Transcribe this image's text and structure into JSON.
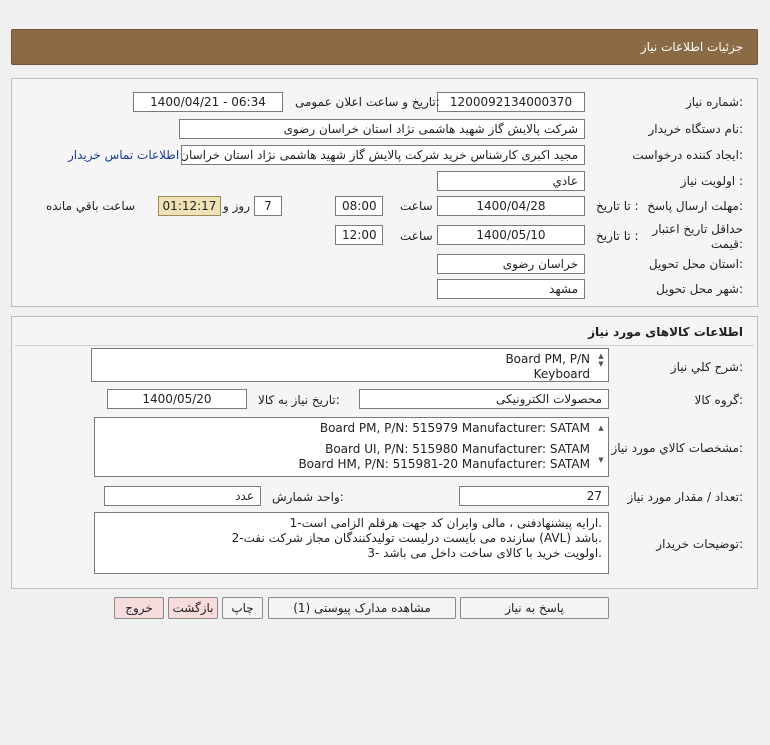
{
  "page_title": "جزئیات اطلاعات نیاز",
  "fields": {
    "need_number_label": "شماره نیاز:",
    "need_number": "1200092134000370",
    "announce_label": "تاریخ و ساعت اعلان عمومی:",
    "announce_value": "1400/04/21 - 06:34",
    "buyer_label": "نام دستگاه خریدار:",
    "buyer_value": "شرکت پالایش گاز شهید هاشمی نژاد   استان خراسان رضوی",
    "creator_label": "ایجاد کننده درخواست:",
    "creator_value": "مجید اکبری کارشناس خرید شرکت پالایش گاز شهید هاشمی نژاد   استان خراسان رضوی",
    "contact_link": "اطلاعات تماس خریدار",
    "priority_label": "اولویت نیاز :",
    "priority_value": "عادي",
    "deadline_label": "مهلت ارسال پاسخ:",
    "to_date_label": "تا تاریخ :",
    "deadline_date": "1400/04/28",
    "time_label": "ساعت",
    "deadline_time": "08:00",
    "days_value": "7",
    "days_label": "روز و",
    "remaining_time": "01:12:17",
    "remaining_label": "ساعت باقي مانده",
    "validity_label_1": "حداقل تاریخ اعتبار",
    "validity_label_2": "قیمت:",
    "validity_date": "1400/05/10",
    "validity_time": "12:00",
    "province_label": "استان محل تحویل:",
    "province_value": "خراسان رضوی",
    "city_label": "شهر محل تحویل:",
    "city_value": "مشهد"
  },
  "goods": {
    "header": "اطلاعات کالاهای مورد نیاز",
    "summary_label": "شرح کلي نياز:",
    "summary_lines": [
      "Board PM, P/N",
      "Keyboard"
    ],
    "group_label": "گروه کالا:",
    "group_value": "محصولات الکترونیکی",
    "need_date_label": "تاریخ نیاز به کالا:",
    "need_date": "1400/05/20",
    "specs_label": "مشخصات کالاي مورد نياز:",
    "specs_lines": [
      "Board PM, P/N: 515979 Manufacturer: SATAM",
      "",
      "Board UI, P/N: 515980 Manufacturer: SATAM",
      "Board HM, P/N: 515981-20 Manufacturer: SATAM"
    ],
    "qty_label": "تعداد / مقدار مورد نیاز:",
    "qty_value": "27",
    "unit_label": "واحد شمارش:",
    "unit_value": "عدد",
    "notes_label": "توضیحات خریدار:",
    "notes_lines": [
      "1-ارایه پیشنهادفنی ، مالی وایران کد جهت هرقلم الزامی است.",
      "2-سازنده می بایست درلیست تولیدکنندگان مجاز شرکت نفت (AVL)  باشد.",
      "3- اولویت خرید  با کالای ساخت  داخل می باشد."
    ]
  },
  "buttons": {
    "respond": "پاسخ به نیاز",
    "view_docs": "مشاهده مدارک پیوستی (1)",
    "print": "چاپ",
    "back": "بازگشت",
    "exit": "خروج"
  }
}
